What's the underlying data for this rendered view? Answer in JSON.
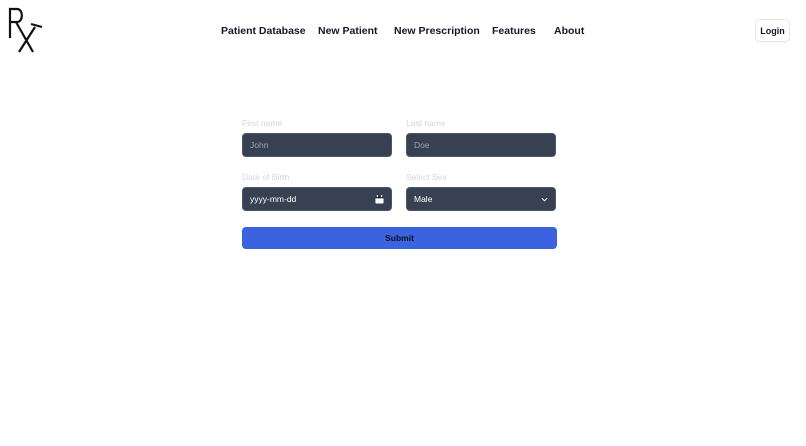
{
  "logo": {
    "alt": "Rx logo"
  },
  "nav": {
    "items": [
      {
        "label": "Patient Database"
      },
      {
        "label": "New Patient"
      },
      {
        "label": "New Prescription"
      },
      {
        "label": "Features"
      },
      {
        "label": "About"
      }
    ],
    "login_label": "Login"
  },
  "form": {
    "first_name": {
      "label": "First name",
      "placeholder": "John",
      "value": ""
    },
    "last_name": {
      "label": "Last name",
      "placeholder": "Doe",
      "value": ""
    },
    "dob": {
      "label": "Date of Birth",
      "display": "yyyy-mm-dd"
    },
    "sex": {
      "label": "Select Sex",
      "selected": "Male"
    },
    "submit_label": "Submit"
  },
  "colors": {
    "input_bg": "#374151",
    "input_border": "#4b5563",
    "label": "#d1d5db",
    "button_accent": "#3b63e0",
    "nav_text": "#111827"
  }
}
